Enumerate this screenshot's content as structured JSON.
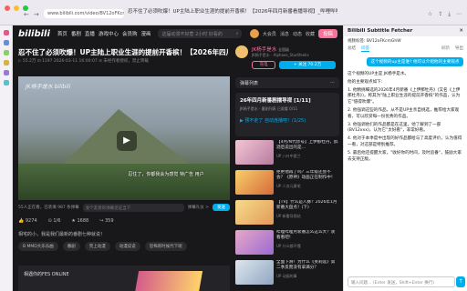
{
  "browser": {
    "url": "www.bilibili.com/video/BV12oFKcmGhW",
    "tab_title": "忍不住了必须吹爆！UP主陆上职业生涯的提前开香槟！【2026年四月新番看播导视】_哔哩哔哩_bilibili",
    "nav_back": "←",
    "nav_forward": "→",
    "icons": [
      "star-icon",
      "share-icon",
      "download-icon",
      "menu-icon"
    ]
  },
  "site": {
    "logo": "bilibili",
    "nav": [
      "首页",
      "番剧",
      "直播",
      "游戏中心",
      "会员购",
      "漫画"
    ],
    "search_placeholder": "这届动漫不好惹 2小时 好看的",
    "search_icon": "⌕",
    "top_icons": [
      "大会员",
      "消息",
      "动态",
      "收藏",
      "历史",
      "创作中心"
    ],
    "post_button": "投稿"
  },
  "video": {
    "title": "忍不住了必须吹爆！UP主陆上职业生涯的提前开香槟！【2026年四月…",
    "meta": "▷ 55.2万  ⊡ 1197  2026-03-11 16:00:07  ⊘ 未经作者授权，禁止转载",
    "watermark": "JK杨手是水 bilibili",
    "subtitle": "忍住了，你都我会为感觉 特广告 用户",
    "danmu_count": "55人正在看，已装填 987 条弹幕",
    "danmu_placeholder": "发个友善的弹幕见证当下",
    "danmu_rules": "弹幕礼仪 >",
    "send": "发送",
    "likes": "9274",
    "coins": "⊙ 1/6",
    "favs": "1688",
    "shares": "359",
    "desc": "相宅的小，我是我们最新的番剧七种就说！",
    "tags": [
      "B MMD大乐乐曲",
      "番剧",
      "完上动漫",
      "动漫说说",
      "恐怖新时候代下呢"
    ],
    "game_banner_title": "相遇你的FES ONLINE"
  },
  "uploader": {
    "name": "JK杨手是水",
    "badge": "全国级",
    "subtitle": "JK杨手是水 ·  Alphaes_Studifeelix",
    "charge": "充电",
    "follow": "+ 关注 70.2万"
  },
  "sidebar_right": {
    "danmu_list": "弹幕列表",
    "danmu_list_icon": "⋯",
    "playlist_title": "26年四月新番剧播导视 [1/11]",
    "playlist_sub": "JK杨手是水  · 番剧列表 已观看 0/11",
    "playlist_link": "▶ 预不走了 自动连播吧！(1/25)",
    "recommendations": [
      {
        "title": "【4月/N代炒号】上伊那牡丹，醉酒后说出的是…",
        "author": "UP 八叶中夏兰",
        "stats": "▷ 29.5万 · 2-17"
      },
      {
        "title": "拒绝他再了吗？三年级还会不会？《原神》动画正在制作中！",
        "author": "UP 二次元黄毛",
        "stats": "▷ 21万 · 4-07"
      },
      {
        "title": "【TV】什么是人脉？2026年1月新番大盘点！(下)",
        "author": "UP 新番导视站",
        "stats": "▷ 17.6万 · 3-21"
      },
      {
        "title": "哔哩哔哩月新番怎么这么大？诶 看看吧！",
        "author": "UP 什么都不懂",
        "stats": "▷ 9.3万 · 2-25"
      },
      {
        "title": "全面下滑！为什么《芙莉莲》第二季反而没有拿满分？",
        "author": "UP 动画的事",
        "stats": "▷ 31.4万 · 3-30"
      }
    ]
  },
  "extension": {
    "title": "Bilibili Subtitle Fetcher",
    "close": "✕",
    "video_id": "视频标签: BV12oFKcmGhW",
    "tabs": [
      "总结",
      "问答"
    ],
    "refresh": "刷新",
    "export": "导出",
    "question": "这个视频的up主是谁? 他可以介绍他的主要观点",
    "answer": [
      "这个视频的UP主是 JK杨手是水。",
      "他的主要观点如下:",
      "1. 他精挑细选的2026年4月新番《上伊那牡丹》(又名《上伊那杜丹》)，称其为\"陆上职业生涯的提前开香槟\"的作品，认为它\"值得吹爆\"。",
      "2. 他强调这些的作品，从不是UP主亲自挑选，推荐给大家观看，可以欣赏每一份优秀的作品。",
      "3. 他强调他们的作品都是在这里，他了解到了一部(BV12xxx)，认为它\"太好看\"，非常好看。",
      "4. 他对于本季度中出现的好作品都给与了高度评价，认为值得一看，对这部是特别推荐。",
      "5. 最后他还提醒大家，\"收好你的时间，及时追番\"，鼓励大家去支持正版。"
    ],
    "input_placeholder": "输入问题… (Enter 发送，Shift+Enter 换行)",
    "send_icon": "↑"
  }
}
